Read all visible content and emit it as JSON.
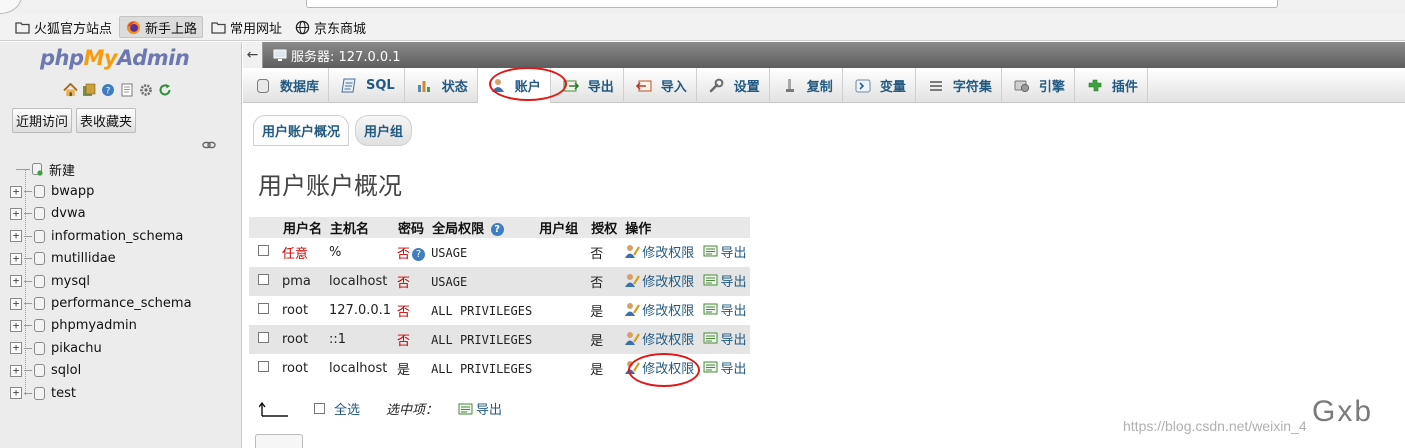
{
  "browser": {
    "bookmarks": [
      {
        "label": "火狐官方站点",
        "icon": "folder-icon"
      },
      {
        "label": "新手上路",
        "icon": "firefox-icon",
        "active": true
      },
      {
        "label": "常用网址",
        "icon": "folder-icon"
      },
      {
        "label": "京东商城",
        "icon": "globe-icon"
      }
    ]
  },
  "nav": {
    "logo": {
      "php": "php",
      "my": "My",
      "admin": "Admin"
    },
    "icons": [
      "home-icon",
      "database-icon",
      "help-icon",
      "docs-icon",
      "gear-icon",
      "reload-icon"
    ],
    "tabs": [
      "近期访问",
      "表收藏夹"
    ],
    "tree_new": "新建",
    "databases": [
      "bwapp",
      "dvwa",
      "information_schema",
      "mutillidae",
      "mysql",
      "performance_schema",
      "phpmyadmin",
      "pikachu",
      "sqlol",
      "test"
    ]
  },
  "server_bar": {
    "label": "服务器: 127.0.0.1"
  },
  "menu": [
    {
      "label": "数据库",
      "icon": "database-icon"
    },
    {
      "label": "SQL",
      "icon": "sql-icon"
    },
    {
      "label": "状态",
      "icon": "status-icon"
    },
    {
      "label": "账户",
      "icon": "accounts-icon",
      "active": true
    },
    {
      "label": "导出",
      "icon": "export-icon"
    },
    {
      "label": "导入",
      "icon": "import-icon"
    },
    {
      "label": "设置",
      "icon": "wrench-icon"
    },
    {
      "label": "复制",
      "icon": "replication-icon"
    },
    {
      "label": "变量",
      "icon": "variables-icon"
    },
    {
      "label": "字符集",
      "icon": "charset-icon"
    },
    {
      "label": "引擎",
      "icon": "engine-icon"
    },
    {
      "label": "插件",
      "icon": "plugin-icon"
    }
  ],
  "subtabs": [
    "用户账户概况",
    "用户组"
  ],
  "page_title": "用户账户概况",
  "table": {
    "headers": [
      "用户名",
      "主机名",
      "密码",
      "全局权限",
      "用户组",
      "授权",
      "操作"
    ],
    "rows": [
      {
        "user": "任意",
        "user_red": true,
        "host": "%",
        "password": "否",
        "password_red": true,
        "password_help": true,
        "privileges": "USAGE",
        "group": "",
        "grant": "否",
        "edit": "修改权限",
        "export": "导出"
      },
      {
        "user": "pma",
        "user_red": false,
        "host": "localhost",
        "password": "否",
        "password_red": true,
        "password_help": false,
        "privileges": "USAGE",
        "group": "",
        "grant": "否",
        "edit": "修改权限",
        "export": "导出"
      },
      {
        "user": "root",
        "user_red": false,
        "host": "127.0.0.1",
        "password": "否",
        "password_red": true,
        "password_help": false,
        "privileges": "ALL PRIVILEGES",
        "group": "",
        "grant": "是",
        "edit": "修改权限",
        "export": "导出"
      },
      {
        "user": "root",
        "user_red": false,
        "host": "::1",
        "password": "否",
        "password_red": true,
        "password_help": false,
        "privileges": "ALL PRIVILEGES",
        "group": "",
        "grant": "是",
        "edit": "修改权限",
        "export": "导出"
      },
      {
        "user": "root",
        "user_red": false,
        "host": "localhost",
        "password": "是",
        "password_red": false,
        "password_help": false,
        "privileges": "ALL PRIVILEGES",
        "group": "",
        "grant": "是",
        "edit": "修改权限",
        "export": "导出"
      }
    ]
  },
  "footer": {
    "select_all": "全选",
    "with_selected": "选中项：",
    "export": "导出"
  },
  "watermark": "https://blog.csdn.net/weixin_4",
  "corner_mark": "Gxb",
  "colors": {
    "link": "#235a81",
    "red": "#cc0000",
    "annotation": "#e01818"
  }
}
